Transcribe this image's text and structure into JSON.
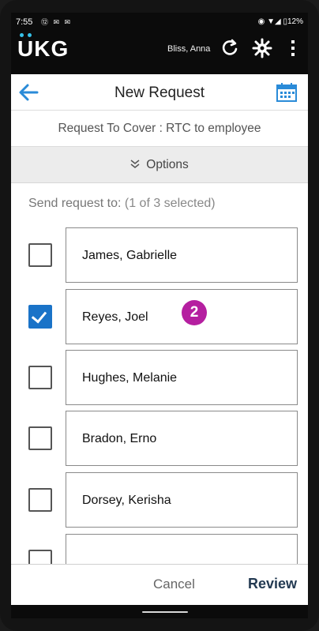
{
  "status_bar": {
    "time": "7:55",
    "notif_icons": "⑫ ✉ ✉",
    "right": "◉ ▼◢ ▯12%"
  },
  "app": {
    "logo": "UKG",
    "user_name": "Bliss, Anna"
  },
  "header": {
    "title": "New Request"
  },
  "request_type": "Request To Cover : RTC to employee",
  "options": {
    "label": "Options",
    "chevron": "chevron-double-down-icon"
  },
  "send_to": {
    "label": "Send request to:",
    "selection_status": "(1 of 3 selected)"
  },
  "employees": [
    {
      "name": "James, Gabrielle",
      "checked": false
    },
    {
      "name": "Reyes, Joel",
      "checked": true
    },
    {
      "name": "Hughes, Melanie",
      "checked": false
    },
    {
      "name": "Bradon, Erno",
      "checked": false
    },
    {
      "name": "Dorsey, Kerisha",
      "checked": false
    },
    {
      "name": "",
      "checked": false
    }
  ],
  "step_badge": "2",
  "actions": {
    "cancel_label": "Cancel",
    "review_label": "Review"
  },
  "colors": {
    "accent_blue": "#1a73c8",
    "badge_magenta": "#b51fa0",
    "review_text": "#233a52",
    "logo_dots": "#35c1e8"
  }
}
